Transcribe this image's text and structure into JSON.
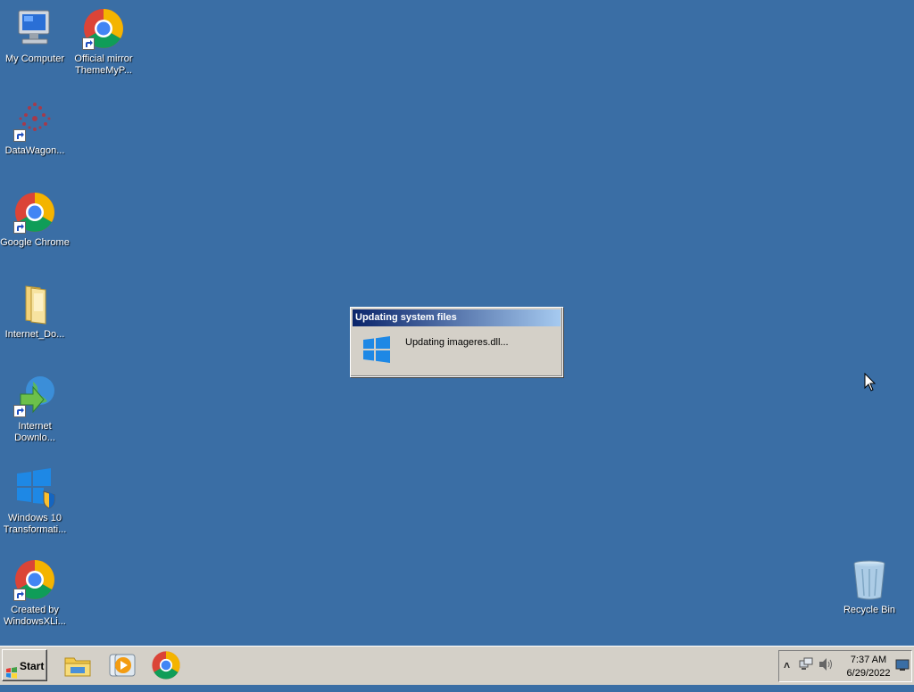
{
  "desktop": {
    "icons": [
      {
        "label": "My Computer"
      },
      {
        "label": "Official mirror ThemeMyP..."
      },
      {
        "label": "DataWagon..."
      },
      {
        "label": "Google Chrome"
      },
      {
        "label": "Internet_Do..."
      },
      {
        "label": "Internet Downlo..."
      },
      {
        "label": "Windows 10 Transformati..."
      },
      {
        "label": "Created by WindowsXLi..."
      },
      {
        "label": "Recycle Bin"
      }
    ]
  },
  "dialog": {
    "title": "Updating system files",
    "message": "Updating imageres.dll..."
  },
  "taskbar": {
    "start_label": "Start",
    "pinned": [
      "file-explorer-icon",
      "media-player-icon",
      "chrome-icon"
    ],
    "tray": {
      "time": "7:37 AM",
      "date": "6/29/2022",
      "icons": [
        "show-hidden-icons-chevron",
        "network-icon",
        "volume-icon",
        "show-desktop-icon"
      ]
    }
  },
  "colors": {
    "desktop_bg": "#3a6ea5",
    "taskbar_bg": "#d4d0c8",
    "titlebar_start": "#0a246a",
    "titlebar_end": "#a6caf0"
  }
}
